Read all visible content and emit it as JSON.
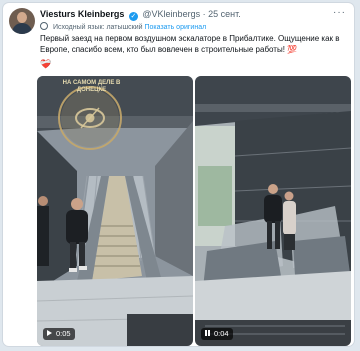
{
  "post": {
    "author_name": "Viesturs Kleinbergs",
    "author_handle": "@VKleinbergs",
    "separator": "·",
    "date": "25 сент.",
    "more_label": "···",
    "translation_note": "Исходный язык: латышский",
    "show_original_label": "Показать оригинал",
    "text": "Первый заезд на первом воздушном эскалаторе в Прибалтике. Ощущение как в Европе, спасибо всем, кто был вовлечен в строительные работы! 💯",
    "emoji": "❤️‍🩹"
  },
  "media": {
    "watermark_text": "НА САМОМ ДЕЛЕ В ДОНЕЦКЕ",
    "left_video": {
      "duration": "0:05"
    },
    "right_video": {
      "duration": "0:04"
    }
  },
  "colors": {
    "link": "#1d9bf0",
    "text": "#0f1419",
    "muted": "#536471"
  }
}
